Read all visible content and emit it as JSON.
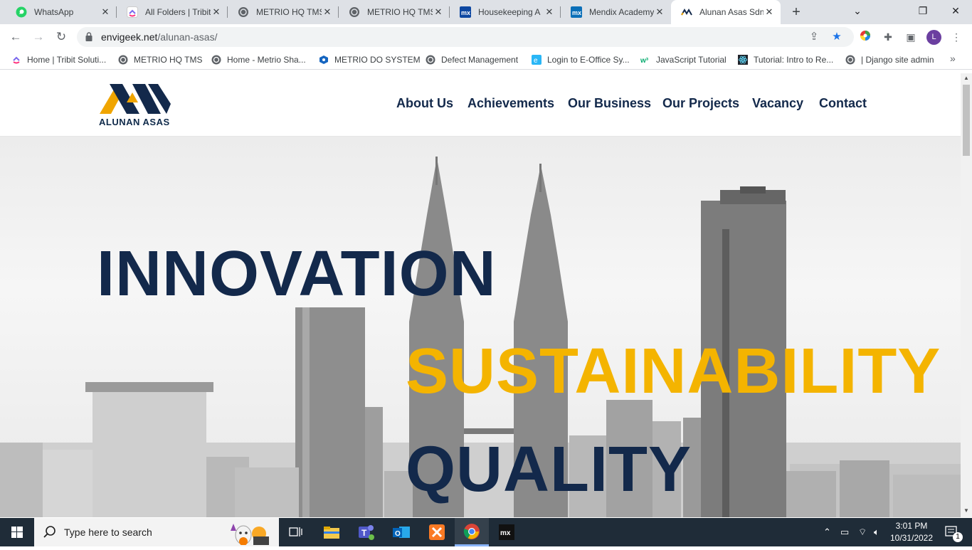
{
  "browser": {
    "tabs": [
      {
        "title": "WhatsApp",
        "icon": "whatsapp-icon"
      },
      {
        "title": "All Folders | Tribit",
        "icon": "clickup-icon"
      },
      {
        "title": "METRIO HQ TMS",
        "icon": "globe-icon"
      },
      {
        "title": "METRIO HQ TMS",
        "icon": "globe-icon"
      },
      {
        "title": "Housekeeping A",
        "icon": "mendix-icon"
      },
      {
        "title": "Mendix Academy",
        "icon": "mendix-icon"
      },
      {
        "title": "Alunan Asas Sdn",
        "icon": "alunan-icon",
        "active": true
      }
    ],
    "new_tab_label": "+",
    "url_domain": "envigeek.net",
    "url_path": "/alunan-asas/",
    "profile_initial": "L",
    "bookmarks": [
      {
        "label": "Home | Tribit Soluti...",
        "icon": "clickup-icon"
      },
      {
        "label": "METRIO HQ TMS",
        "icon": "globe-icon"
      },
      {
        "label": "Home - Metrio Sha...",
        "icon": "globe-icon"
      },
      {
        "label": "METRIO DO SYSTEM",
        "icon": "metrio-icon"
      },
      {
        "label": "Defect Management",
        "icon": "globe-icon"
      },
      {
        "label": "Login to E-Office Sy...",
        "icon": "eoffice-icon"
      },
      {
        "label": "JavaScript Tutorial",
        "icon": "w3-icon"
      },
      {
        "label": "Tutorial: Intro to Re...",
        "icon": "react-icon"
      },
      {
        "label": "| Django site admin",
        "icon": "globe-icon"
      }
    ]
  },
  "site": {
    "logo_text": "ALUNAN ASAS",
    "nav": [
      "About Us",
      "Achievements",
      "Our Business",
      "Our Projects",
      "Vacancy",
      "Contact"
    ],
    "hero": {
      "word1": "INNOVATION",
      "word2": "SUSTAINABILITY",
      "word3": "QUALITY"
    },
    "colors": {
      "navy": "#13294b",
      "gold": "#f4b400",
      "logo_gold": "#f0a500"
    }
  },
  "taskbar": {
    "search_placeholder": "Type here to search",
    "time": "3:01 PM",
    "date": "10/31/2022",
    "notification_count": "1"
  }
}
